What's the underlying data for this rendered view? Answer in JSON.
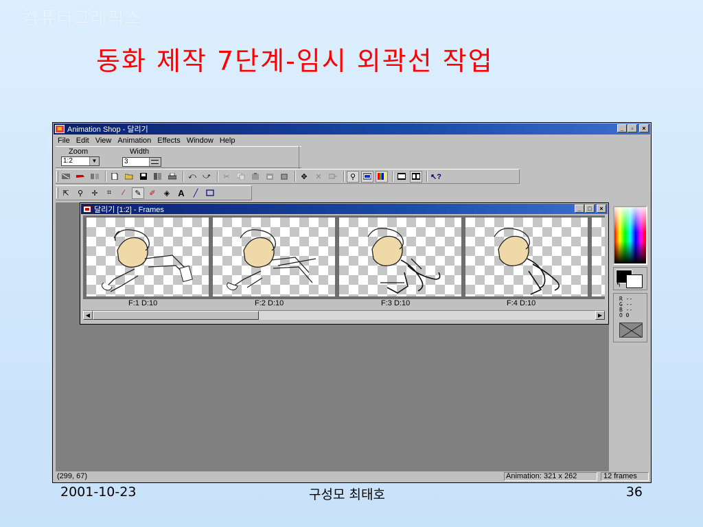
{
  "slide": {
    "header": "컴퓨터그래픽스",
    "title": "동화 제작 7단계-임시 외곽선 작업",
    "footer_date": "2001-10-23",
    "footer_author": "구성모 최태호",
    "footer_page": "36"
  },
  "app": {
    "title": "Animation Shop - 달리기",
    "window_buttons": [
      "_",
      "▫",
      "×"
    ],
    "menu": [
      "File",
      "Edit",
      "View",
      "Animation",
      "Effects",
      "Window",
      "Help"
    ],
    "properties": {
      "zoom_label": "Zoom",
      "zoom_value": "1:2",
      "width_label": "Width",
      "width_value": "3"
    },
    "toolbar1_icons": [
      "wizard-icon",
      "banner-wizard-icon",
      "transition-wizard-icon",
      "new-icon",
      "open-icon",
      "save-icon",
      "save-as-icon",
      "print-icon",
      "undo-icon",
      "redo-icon",
      "cut-icon",
      "copy-icon",
      "paste-icon",
      "paste-new-icon",
      "paste-frame-icon",
      "properties-icon",
      "crop-frame-icon",
      "resize-icon",
      "zoom-icon",
      "frame-view-icon",
      "palette-icon",
      "filmstrip-icon",
      "play-icon",
      "help-icon"
    ],
    "toolbar2_icons": [
      "arrow-tool-icon",
      "zoom-tool-icon",
      "mover-tool-icon",
      "crop-tool-icon",
      "dropper-tool-icon",
      "brush-tool-icon",
      "eraser-tool-icon",
      "fill-tool-icon",
      "text-tool-icon",
      "line-tool-icon",
      "shape-tool-icon"
    ],
    "frames_window": {
      "title": "달리기 [1:2] - Frames",
      "buttons": [
        "_",
        "□",
        "×"
      ],
      "frames": [
        {
          "label": "F:1  D:10"
        },
        {
          "label": "F:2  D:10"
        },
        {
          "label": "F:3  D:10"
        },
        {
          "label": "F:4  D:10"
        }
      ]
    },
    "info": {
      "r": "R --",
      "g": "G --",
      "b": "B --",
      "o": "O 0"
    },
    "status": {
      "coords": "(299, 67)",
      "animation": "Animation: 321 x 262",
      "frames": "12 frames"
    }
  }
}
